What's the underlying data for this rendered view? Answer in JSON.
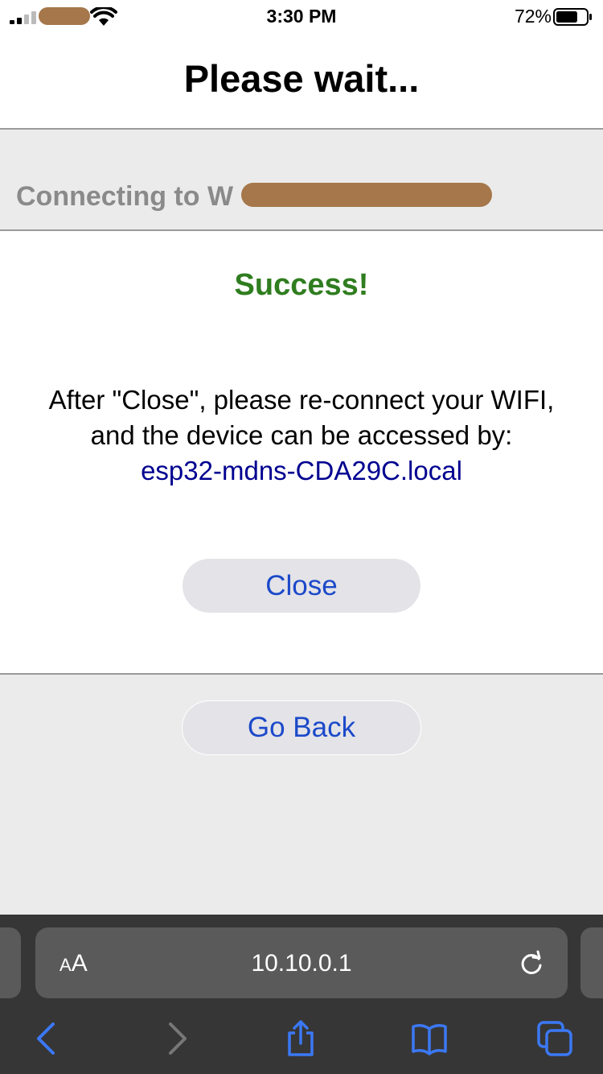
{
  "status_bar": {
    "time": "3:30 PM",
    "battery_percent": "72%",
    "battery_level": 0.72,
    "signal_bars": 2
  },
  "header": {
    "title": "Please wait..."
  },
  "connecting": {
    "text": "Connecting to W"
  },
  "result": {
    "title": "Success!",
    "line1": "After \"Close\", please re-connect your WIFI,",
    "line2": "and the device can be accessed by:",
    "mdns_host": "esp32-mdns-CDA29C.local",
    "close_label": "Close"
  },
  "go_back_label": "Go Back",
  "browser": {
    "aa_small": "A",
    "aa_big": "A",
    "url": "10.10.0.1"
  },
  "colors": {
    "success": "#2f7d1f",
    "link": "#000090",
    "button_text": "#1b49c9",
    "toolbar_icon": "#3b78f5"
  },
  "icons": {
    "reload": "reload-icon",
    "back": "chevron-left-icon",
    "forward": "chevron-right-icon",
    "share": "share-icon",
    "bookmarks": "book-icon",
    "tabs": "tabs-icon"
  }
}
